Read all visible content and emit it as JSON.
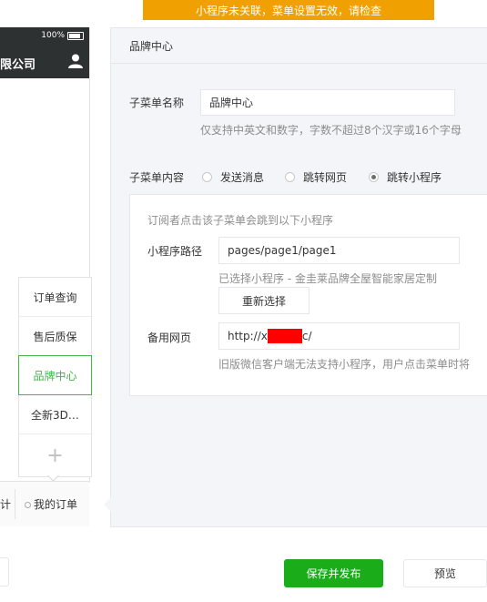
{
  "banner": {
    "text": "小程序未关联，菜单设置无效，请检查"
  },
  "phone": {
    "battery": "100%",
    "title": "限公司",
    "submenu": [
      "订单查询",
      "售后质保",
      "品牌中心",
      "全新3D…"
    ],
    "submenu_add": "+",
    "menubar": {
      "prev": "计",
      "current": "我的订单"
    }
  },
  "editor": {
    "title": "品牌中心",
    "name_label": "子菜单名称",
    "name_value": "品牌中心",
    "name_hint": "仅支持中英文和数字，字数不超过8个汉字或16个字母",
    "content_label": "子菜单内容",
    "radios": [
      "发送消息",
      "跳转网页",
      "跳转小程序"
    ],
    "selected_radio": "跳转小程序",
    "box_desc": "订阅者点击该子菜单会跳到以下小程序",
    "path_label": "小程序路径",
    "path_value": "pages/page1/page1",
    "selected_hint": "已选择小程序 - 金圭莱品牌全屋智能家居定制",
    "reselect_label": "重新选择",
    "backup_label": "备用网页",
    "backup_prefix": "http://x",
    "backup_suffix": "c/",
    "backup_hint": "旧版微信客户端无法支持小程序，用户点击菜单时将"
  },
  "footer": {
    "save_publish": "保存并发布",
    "preview": "预览"
  },
  "colors": {
    "banner": "#f0a000",
    "primary": "#1aad19",
    "active": "#44b549",
    "redaction": "#ff0000"
  }
}
